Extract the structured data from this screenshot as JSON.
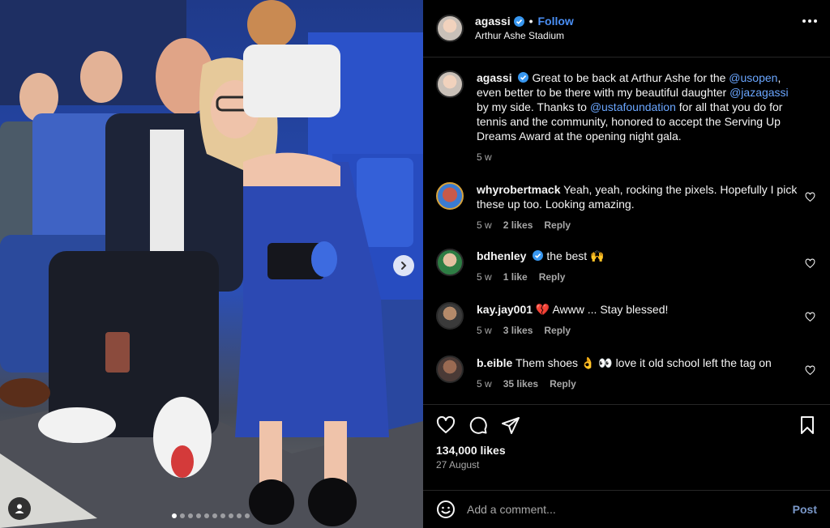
{
  "post": {
    "author": "agassi",
    "follow_label": "Follow",
    "location": "Arthur Ashe Stadium",
    "separator": "•",
    "photo": {
      "image_count": 10,
      "active_index": 0
    }
  },
  "caption": {
    "username": "agassi",
    "segments": [
      {
        "text": "Great to be back at Arthur Ashe for the "
      },
      {
        "text": "@usopen",
        "mention": true
      },
      {
        "text": ", even better to be there with my beautiful daughter "
      },
      {
        "text": "@jazagassi",
        "mention": true
      },
      {
        "text": " by my side. Thanks to "
      },
      {
        "text": "@ustafoundation",
        "mention": true
      },
      {
        "text": " for all that you do for tennis and the community, honored to accept the Serving Up Dreams Award at the opening night gala."
      }
    ],
    "time": "5 w"
  },
  "comments": [
    {
      "username": "whyrobertmack",
      "verified": false,
      "text": "Yeah, yeah, rocking the pixels. Hopefully I pick these up too. Looking amazing.",
      "time": "5 w",
      "likes": "2 likes",
      "reply": "Reply"
    },
    {
      "username": "bdhenley",
      "verified": true,
      "text": "the best 🙌",
      "time": "5 w",
      "likes": "1 like",
      "reply": "Reply"
    },
    {
      "username": "kay.jay001",
      "verified": false,
      "text": "💔 Awww ... Stay blessed!",
      "time": "5 w",
      "likes": "3 likes",
      "reply": "Reply"
    },
    {
      "username": "b.eible",
      "verified": false,
      "text": "Them shoes 👌 👀 love it old school left the tag on",
      "time": "5 w",
      "likes": "35 likes",
      "reply": "Reply"
    }
  ],
  "stats": {
    "likes": "134,000 likes",
    "date": "27 August"
  },
  "composer": {
    "placeholder": "Add a comment...",
    "post_label": "Post"
  },
  "colors": {
    "background": "#000000",
    "link": "#4a8ff5",
    "verified": "#3897f0",
    "muted": "#a8a8a8"
  }
}
